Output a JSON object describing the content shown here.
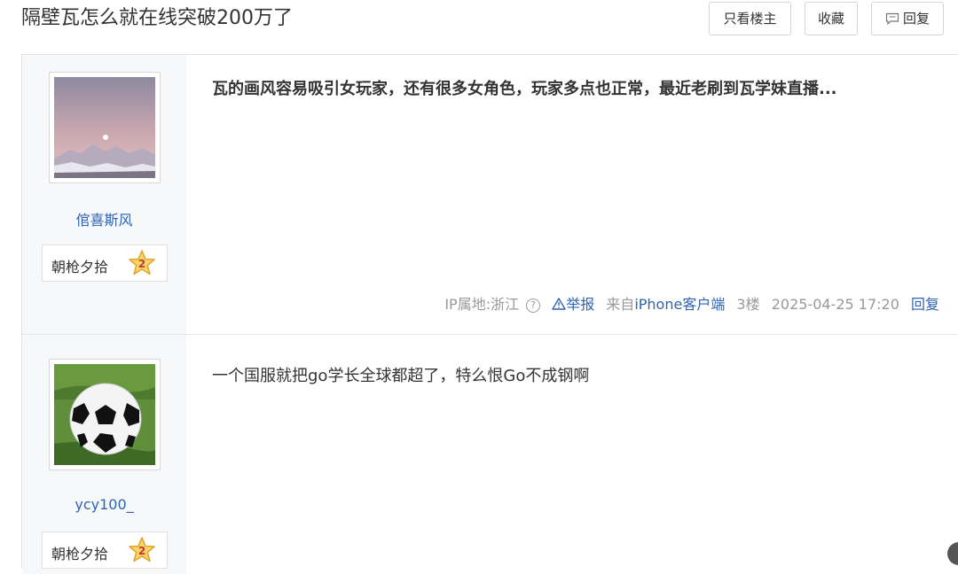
{
  "thread": {
    "title": "隔壁瓦怎么就在线突破200万了",
    "buttons": {
      "only_op": "只看楼主",
      "favorite": "收藏",
      "reply": "回复"
    }
  },
  "posts": [
    {
      "username": "倌喜斯风",
      "badge": {
        "name": "朝枪夕拾",
        "level": "2"
      },
      "content": "瓦的画风容易吸引女玩家，还有很多女角色，玩家多点也正常，最近老刷到瓦学妹直播...",
      "tail": {
        "ip": "IP属地:浙江",
        "report": "举报",
        "source_prefix": "来自",
        "source_client": "iPhone客户端",
        "floor": "3楼",
        "time": "2025-04-25 17:20",
        "reply": "回复"
      }
    },
    {
      "username": "ycy100_",
      "badge": {
        "name": "朝枪夕拾",
        "level": "2"
      },
      "content": "一个国服就把go学长全球都超了，特么恨Go不成钢啊"
    }
  ],
  "icons": [
    "reply-icon",
    "question-icon",
    "warning-icon",
    "star-badge-icon"
  ],
  "colors": {
    "link": "#2d64b3",
    "sidebar_bg": "#f7f8fa",
    "meta": "#999999"
  }
}
